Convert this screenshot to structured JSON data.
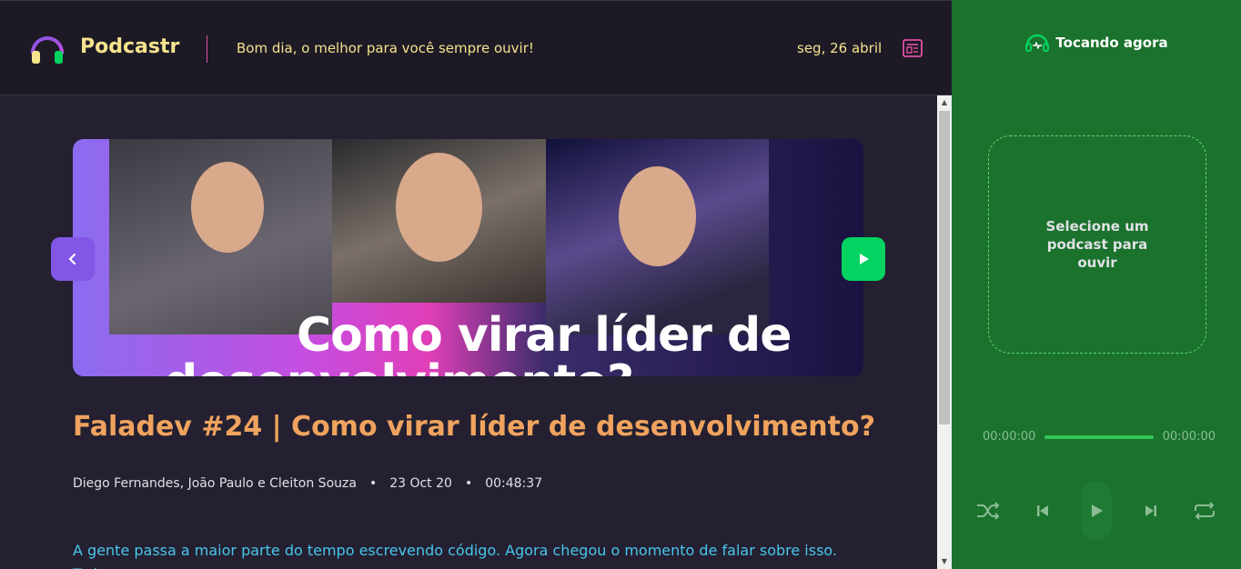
{
  "header": {
    "logo_text": "Podcastr",
    "greeting": "Bom dia, o melhor para você sempre ouvir!",
    "date": "seg, 26 abril",
    "accent_color": "#f6e38d",
    "divider_color": "#e44fa2"
  },
  "episode": {
    "thumbnail_text_line1": "Como virar líder de",
    "thumbnail_text_line2": "desenvolvimento?",
    "title": "Faladev #24 | Como virar líder de desenvolvimento?",
    "members": "Diego Fernandes, João Paulo e Cleiton Souza",
    "published_at": "23 Oct 20",
    "duration": "00:48:37",
    "description": "A gente passa a maior parte do tempo escrevendo código. Agora chegou o momento de falar sobre isso. Toda"
  },
  "player": {
    "heading": "Tocando agora",
    "empty_message": "Selecione um podcast para ouvir",
    "current_time": "00:00:00",
    "total_time": "00:00:00",
    "background_color": "#1a722d"
  },
  "icons": {
    "logo": "headphones-icon",
    "news": "newspaper-icon",
    "prev": "chevron-left-icon",
    "play": "play-icon",
    "player_head": "headphones-icon",
    "shuffle": "shuffle-icon",
    "previous": "skip-previous-icon",
    "next": "skip-next-icon",
    "repeat": "repeat-icon"
  }
}
